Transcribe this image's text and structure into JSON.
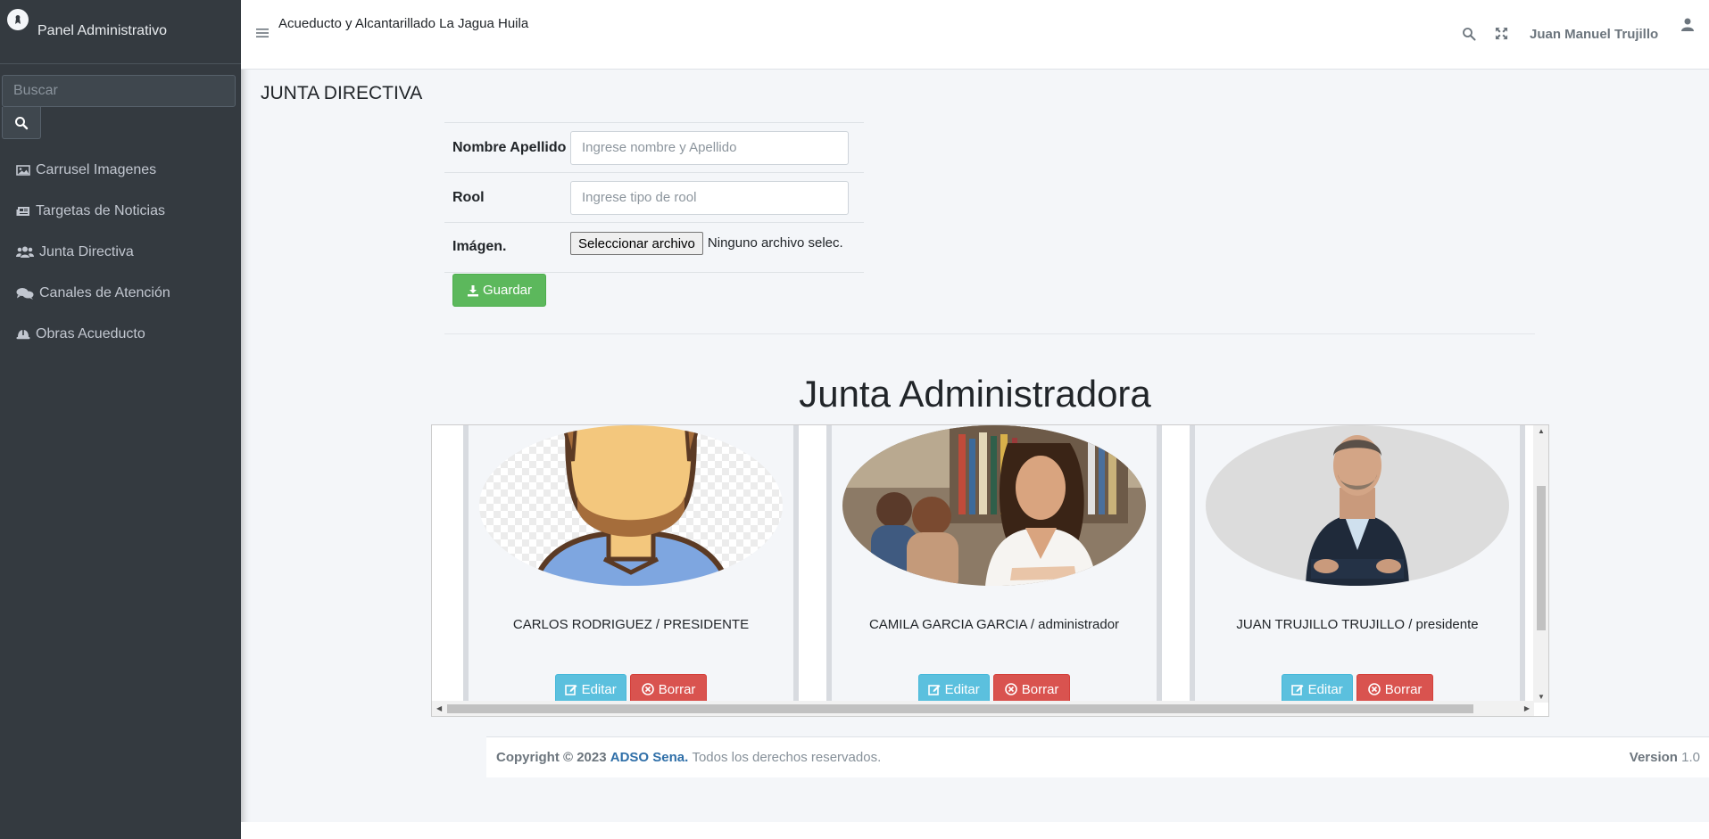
{
  "sidebar": {
    "brand": "Panel Administrativo",
    "search_placeholder": "Buscar",
    "items": [
      {
        "label": "Carrusel Imagenes",
        "icon": "images-icon"
      },
      {
        "label": "Targetas de Noticias",
        "icon": "newspaper-icon"
      },
      {
        "label": "Junta Directiva",
        "icon": "users-icon"
      },
      {
        "label": "Canales de Atención",
        "icon": "comments-icon"
      },
      {
        "label": "Obras Acueducto",
        "icon": "hard-hat-icon"
      }
    ]
  },
  "header": {
    "title": "Acueducto y Alcantarillado La Jagua Huila",
    "user_name": "Juan Manuel Trujillo"
  },
  "page": {
    "title": "JUNTA DIRECTIVA"
  },
  "form": {
    "name_label": "Nombre Apellido",
    "name_placeholder": "Ingrese nombre y Apellido",
    "role_label": "Rool",
    "role_placeholder": "Ingrese tipo de rool",
    "image_label": "Imágen.",
    "file_button": "Seleccionar archivo",
    "file_status": "Ninguno archivo selec.",
    "save_label": "Guardar"
  },
  "section": {
    "title": "Junta Administradora"
  },
  "members": [
    {
      "name": "CARLOS RODRIGUEZ /  PRESIDENTE",
      "edit": "Editar",
      "delete": "Borrar"
    },
    {
      "name": "CAMILA GARCIA GARCIA /  administrador",
      "edit": "Editar",
      "delete": "Borrar"
    },
    {
      "name": "JUAN TRUJILLO TRUJILLO /  presidente",
      "edit": "Editar",
      "delete": "Borrar"
    }
  ],
  "footer": {
    "copyright": "Copyright © 2023",
    "org": "ADSO Sena.",
    "rights": "Todos los derechos reservados.",
    "version_label": "Version",
    "version_value": "1.0"
  },
  "colors": {
    "sidebar_bg": "#343a40",
    "success": "#5cb85c",
    "info": "#5bc0de",
    "danger": "#d9534f"
  }
}
